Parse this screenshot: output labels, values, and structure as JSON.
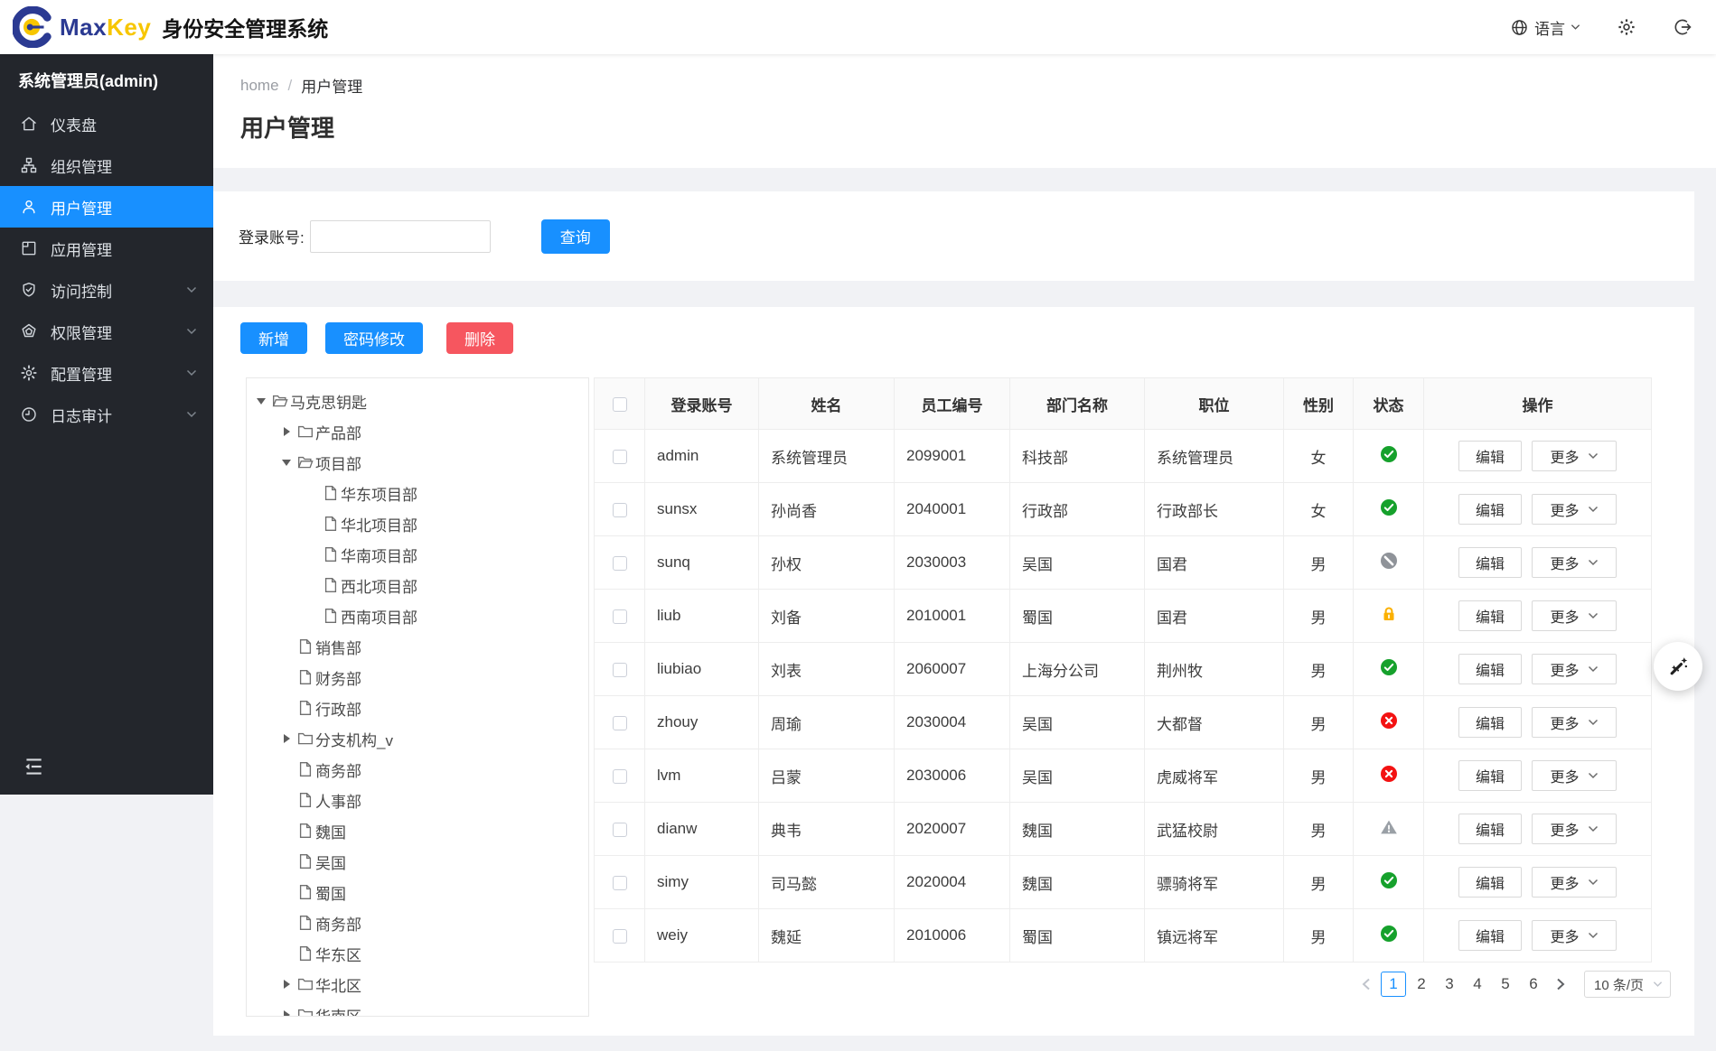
{
  "header": {
    "app_name_max": "Max",
    "app_name_key": "Key",
    "app_title": "身份安全管理系统",
    "language": "语言"
  },
  "sidebar": {
    "user_label": "系统管理员(admin)",
    "items": [
      {
        "key": "dashboard",
        "label": "仪表盘",
        "icon": "home-icon",
        "active": false,
        "expandable": false
      },
      {
        "key": "organizations",
        "label": "组织管理",
        "icon": "org-icon",
        "active": false,
        "expandable": false
      },
      {
        "key": "users",
        "label": "用户管理",
        "icon": "user-icon",
        "active": true,
        "expandable": false
      },
      {
        "key": "applications",
        "label": "应用管理",
        "icon": "app-icon",
        "active": false,
        "expandable": false
      },
      {
        "key": "access-control",
        "label": "访问控制",
        "icon": "shield-icon",
        "active": false,
        "expandable": true
      },
      {
        "key": "permissions",
        "label": "权限管理",
        "icon": "gem-icon",
        "active": false,
        "expandable": true
      },
      {
        "key": "config",
        "label": "配置管理",
        "icon": "gear-icon",
        "active": false,
        "expandable": true
      },
      {
        "key": "audit",
        "label": "日志审计",
        "icon": "clock-icon",
        "active": false,
        "expandable": true
      }
    ]
  },
  "breadcrumb": {
    "home": "home",
    "separator": "/",
    "current": "用户管理"
  },
  "page": {
    "title": "用户管理"
  },
  "search": {
    "label": "登录账号:",
    "value": "",
    "button": "查询"
  },
  "toolbar": {
    "add": "新增",
    "change_password": "密码修改",
    "delete": "删除"
  },
  "tree": {
    "items": [
      {
        "label": "马克思钥匙",
        "icon": "folder-open-icon",
        "caret": "down",
        "level": 0
      },
      {
        "label": "产品部",
        "icon": "folder-icon",
        "caret": "right",
        "level": 1
      },
      {
        "label": "项目部",
        "icon": "folder-open-icon",
        "caret": "down",
        "level": 1
      },
      {
        "label": "华东项目部",
        "icon": "file-icon",
        "caret": null,
        "level": 2
      },
      {
        "label": "华北项目部",
        "icon": "file-icon",
        "caret": null,
        "level": 2
      },
      {
        "label": "华南项目部",
        "icon": "file-icon",
        "caret": null,
        "level": 2
      },
      {
        "label": "西北项目部",
        "icon": "file-icon",
        "caret": null,
        "level": 2
      },
      {
        "label": "西南项目部",
        "icon": "file-icon",
        "caret": null,
        "level": 2
      },
      {
        "label": "销售部",
        "icon": "file-icon",
        "caret": null,
        "level": 1
      },
      {
        "label": "财务部",
        "icon": "file-icon",
        "caret": null,
        "level": 1
      },
      {
        "label": "行政部",
        "icon": "file-icon",
        "caret": null,
        "level": 1
      },
      {
        "label": "分支机构_v",
        "icon": "folder-icon",
        "caret": "right",
        "level": 1
      },
      {
        "label": "商务部",
        "icon": "file-icon",
        "caret": null,
        "level": 1
      },
      {
        "label": "人事部",
        "icon": "file-icon",
        "caret": null,
        "level": 1
      },
      {
        "label": "魏国",
        "icon": "file-icon",
        "caret": null,
        "level": 1
      },
      {
        "label": "吴国",
        "icon": "file-icon",
        "caret": null,
        "level": 1
      },
      {
        "label": "蜀国",
        "icon": "file-icon",
        "caret": null,
        "level": 1
      },
      {
        "label": "商务部",
        "icon": "file-icon",
        "caret": null,
        "level": 1
      },
      {
        "label": "华东区",
        "icon": "file-icon",
        "caret": null,
        "level": 1
      },
      {
        "label": "华北区",
        "icon": "folder-icon",
        "caret": "right",
        "level": 1
      },
      {
        "label": "华南区",
        "icon": "folder-icon",
        "caret": "right",
        "level": 1
      }
    ]
  },
  "table": {
    "headers": [
      "登录账号",
      "姓名",
      "员工编号",
      "部门名称",
      "职位",
      "性别",
      "状态",
      "操作"
    ],
    "edit_label": "编辑",
    "more_label": "更多",
    "rows": [
      {
        "account": "admin",
        "name": "系统管理员",
        "employee_id": "2099001",
        "department": "科技部",
        "position": "系统管理员",
        "gender": "女",
        "status": "active"
      },
      {
        "account": "sunsx",
        "name": "孙尚香",
        "employee_id": "2040001",
        "department": "行政部",
        "position": "行政部长",
        "gender": "女",
        "status": "active"
      },
      {
        "account": "sunq",
        "name": "孙权",
        "employee_id": "2030003",
        "department": "吴国",
        "position": "国君",
        "gender": "男",
        "status": "disabled"
      },
      {
        "account": "liub",
        "name": "刘备",
        "employee_id": "2010001",
        "department": "蜀国",
        "position": "国君",
        "gender": "男",
        "status": "locked"
      },
      {
        "account": "liubiao",
        "name": "刘表",
        "employee_id": "2060007",
        "department": "上海分公司",
        "position": "荆州牧",
        "gender": "男",
        "status": "active"
      },
      {
        "account": "zhouy",
        "name": "周瑜",
        "employee_id": "2030004",
        "department": "吴国",
        "position": "大都督",
        "gender": "男",
        "status": "inactive"
      },
      {
        "account": "lvm",
        "name": "吕蒙",
        "employee_id": "2030006",
        "department": "吴国",
        "position": "虎威将军",
        "gender": "男",
        "status": "inactive"
      },
      {
        "account": "dianw",
        "name": "典韦",
        "employee_id": "2020007",
        "department": "魏国",
        "position": "武猛校尉",
        "gender": "男",
        "status": "warning"
      },
      {
        "account": "simy",
        "name": "司马懿",
        "employee_id": "2020004",
        "department": "魏国",
        "position": "骠骑将军",
        "gender": "男",
        "status": "active"
      },
      {
        "account": "weiy",
        "name": "魏延",
        "employee_id": "2010006",
        "department": "蜀国",
        "position": "镇远将军",
        "gender": "男",
        "status": "active"
      }
    ]
  },
  "pagination": {
    "pages": [
      "1",
      "2",
      "3",
      "4",
      "5",
      "6"
    ],
    "active": "1",
    "page_size": "10 条/页"
  },
  "colors": {
    "primary": "#1890ff",
    "danger": "#f6565f",
    "sidebar_bg": "#23262c",
    "brand_navy": "#2b3a92",
    "brand_gold": "#f7c600",
    "status_active": "#16a12c",
    "status_inactive": "#f31212",
    "status_disabled": "#8f9399",
    "status_locked": "#fbb000",
    "status_warning": "#9aa0a6"
  }
}
